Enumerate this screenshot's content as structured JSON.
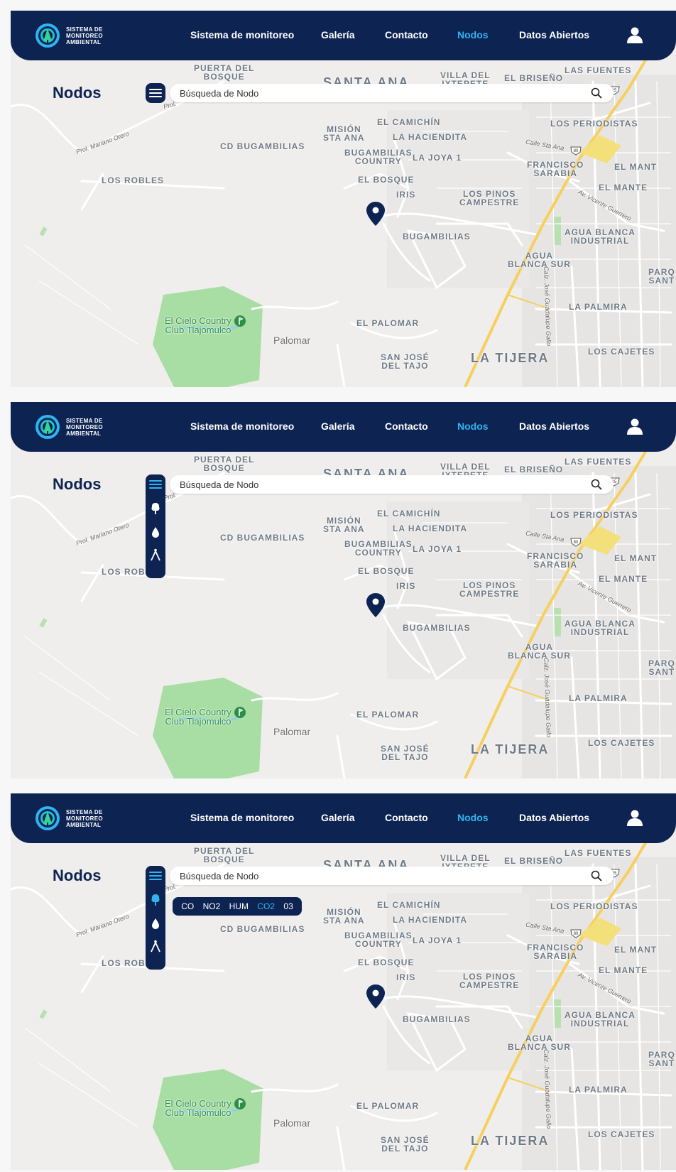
{
  "header": {
    "logo_lines": [
      "SISTEMA DE",
      "MONITOREO",
      "AMBIENTAL"
    ],
    "nav": [
      {
        "label": "Sistema de monitoreo",
        "active": false
      },
      {
        "label": "Galería",
        "active": false
      },
      {
        "label": "Contacto",
        "active": false
      },
      {
        "label": "Nodos",
        "active": true
      },
      {
        "label": "Datos Abiertos",
        "active": false
      }
    ]
  },
  "page_title": "Nodos",
  "search": {
    "placeholder": "Búsqueda de Nodo"
  },
  "pollutants": [
    {
      "label": "CO",
      "active": false
    },
    {
      "label": "NO2",
      "active": false
    },
    {
      "label": "HUM",
      "active": false
    },
    {
      "label": "CO2",
      "active": true
    },
    {
      "label": "03",
      "active": false
    }
  ],
  "map_labels": {
    "puerta_del_bosque": "PUERTA DEL\nBOSQUE",
    "santa_ana": "SANTA ANA",
    "villa_del_iztepete": "VILLA DEL\nIXTEPETE",
    "el briseno": "EL BRISEÑO",
    "las_fuentes": "LAS FUENTES",
    "el_camichin": "EL CAMICHÍN",
    "mision_sta_ana": "MISIÓN\nSTA ANA",
    "la_hacienda": "LA HACIENDITA",
    "los_periodistas": "LOS PERIODISTAS",
    "cd_bugambilias": "CD BUGAMBILIAS",
    "bugambilias_country": "BUGAMBILIAS\nCOUNTRY",
    "la_joya": "LA JOYA 1",
    "francisco_sarabia": "FRANCISCO\nSARABIA",
    "el_mant": "EL MANT",
    "los_robles": "LOS ROBLES",
    "el_bosque": "EL BOSQUE",
    "iris": "IRIS",
    "los_pinos": "LOS PINOS\nCAMPESTRE",
    "el_mante": "EL MANTE",
    "bugambilias": "BUGAMBILIAS",
    "agua_blanca_ind": "AGUA BLANCA\nINDUSTRIAL",
    "agua_blanca_sur": "AGUA\nBLANCA SUR",
    "parq_sant": "PARQ\nSANT",
    "la_palmira": "LA PALMIRA",
    "el_cielo": "El Cielo Country\nClub Tlajomulco",
    "el_palomar": "EL PALOMAR",
    "palomar": "Palomar",
    "san_jose": "SAN JOSÉ\nDEL TAJO",
    "la_tijera": "LA TIJERA",
    "los_cajetes": "LOS CAJETES",
    "prol_mariano": "Prol. Mariano Otero",
    "calle_sta_ana": "Calle Sta Ana",
    "av_vicente": "Av. Vicente Guerrero",
    "calz_jose": "Calz. José Guadalupe Gallo",
    "prol": "Prol.",
    "highway_80": "80",
    "highway_15": "15"
  },
  "colors": {
    "navy": "#0d2352",
    "accent": "#2fb4f0",
    "map_bg": "#efeeec",
    "highway": "#f6cf5e",
    "park": "#a8dda3"
  },
  "icons": {
    "menu": "hamburger-icon",
    "tree": "tree-icon",
    "water": "water-drop-icon",
    "compass": "compass-icon",
    "search": "search-icon",
    "user": "user-icon",
    "marker": "map-pin-icon"
  }
}
